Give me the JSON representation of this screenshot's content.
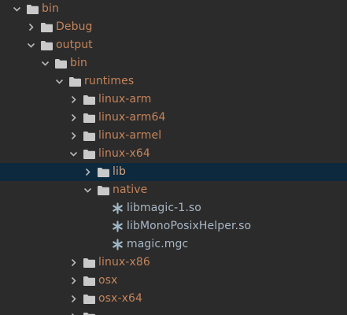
{
  "colors": {
    "background": "#2b2b2b",
    "selection": "#0d293e",
    "folder_label": "#c5845b",
    "file_label": "#a9b7c6",
    "folder_icon": "#c9c9c9",
    "chevron": "#b8b8b8"
  },
  "tree": {
    "nodes": [
      {
        "label": "bin",
        "type": "folder",
        "expanded": true
      },
      {
        "label": "Debug",
        "type": "folder",
        "expanded": false
      },
      {
        "label": "output",
        "type": "folder",
        "expanded": true
      },
      {
        "label": "bin",
        "type": "folder",
        "expanded": true
      },
      {
        "label": "runtimes",
        "type": "folder",
        "expanded": true
      },
      {
        "label": "linux-arm",
        "type": "folder",
        "expanded": false
      },
      {
        "label": "linux-arm64",
        "type": "folder",
        "expanded": false
      },
      {
        "label": "linux-armel",
        "type": "folder",
        "expanded": false
      },
      {
        "label": "linux-x64",
        "type": "folder",
        "expanded": true
      },
      {
        "label": "lib",
        "type": "folder",
        "expanded": false,
        "selected": true
      },
      {
        "label": "native",
        "type": "folder",
        "expanded": true
      },
      {
        "label": "libmagic-1.so",
        "type": "file",
        "icon": "asterisk-file-icon"
      },
      {
        "label": "libMonoPosixHelper.so",
        "type": "file",
        "icon": "asterisk-file-icon"
      },
      {
        "label": "magic.mgc",
        "type": "file",
        "icon": "asterisk-file-icon"
      },
      {
        "label": "linux-x86",
        "type": "folder",
        "expanded": false
      },
      {
        "label": "osx",
        "type": "folder",
        "expanded": false
      },
      {
        "label": "osx-x64",
        "type": "folder",
        "expanded": false
      }
    ]
  }
}
